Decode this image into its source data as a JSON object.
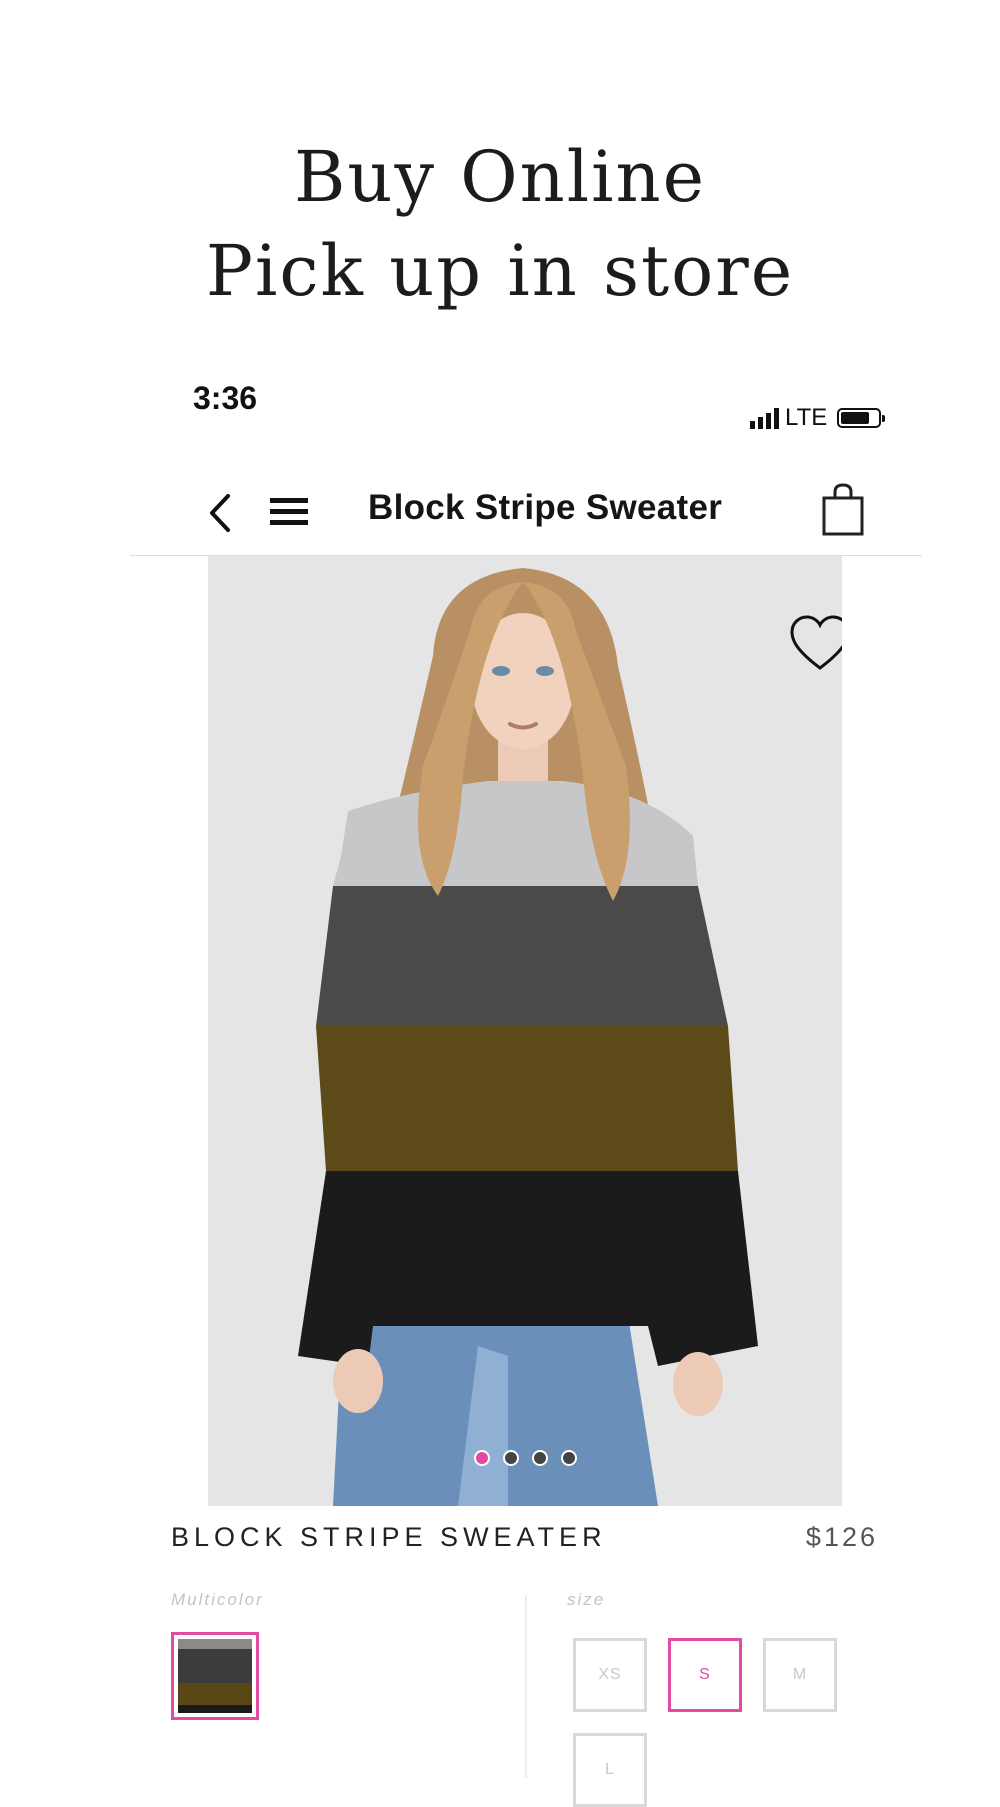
{
  "headline": {
    "line1": "Buy Online",
    "line2": "Pick up in store"
  },
  "status_bar": {
    "time": "3:36",
    "network": "LTE"
  },
  "nav": {
    "title": "Block Stripe Sweater"
  },
  "gallery": {
    "image_count": 4,
    "active_index": 0
  },
  "product": {
    "name": "BLOCK STRIPE SWEATER",
    "price": "$126",
    "color_label": "Multicolor",
    "size_label": "size",
    "sizes": [
      "XS",
      "S",
      "M",
      "L"
    ],
    "selected_size": "S"
  },
  "colors": {
    "accent": "#e14aa5",
    "image_bg": "#e6e5e6"
  }
}
